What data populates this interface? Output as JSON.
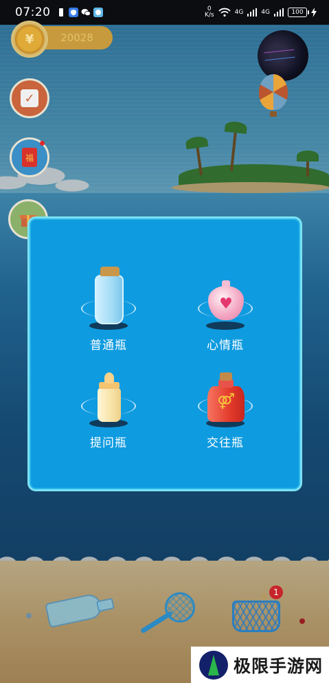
{
  "status_bar": {
    "time": "07:20",
    "net_speed_value": "0",
    "net_speed_unit": "K/s",
    "signal1_label": "4G",
    "signal2_label": "4G",
    "battery": "100"
  },
  "hud": {
    "coin_symbol": "¥",
    "coin_count": "20028",
    "red_packet_glyph": "福"
  },
  "modal": {
    "items": [
      {
        "label": "普通瓶",
        "icon": "glass-bottle-icon"
      },
      {
        "label": "心情瓶",
        "icon": "heart-bottle-icon"
      },
      {
        "label": "提问瓶",
        "icon": "baby-bottle-icon"
      },
      {
        "label": "交往瓶",
        "icon": "gender-bottle-icon"
      }
    ]
  },
  "beach": {
    "basket_badge": "1"
  },
  "watermark": {
    "text": "极限手游网"
  },
  "colors": {
    "modal_bg": "#0f9be0",
    "modal_border": "#7be2f5",
    "status_bar": "#0b0d10",
    "badge_red": "#c6262a"
  }
}
